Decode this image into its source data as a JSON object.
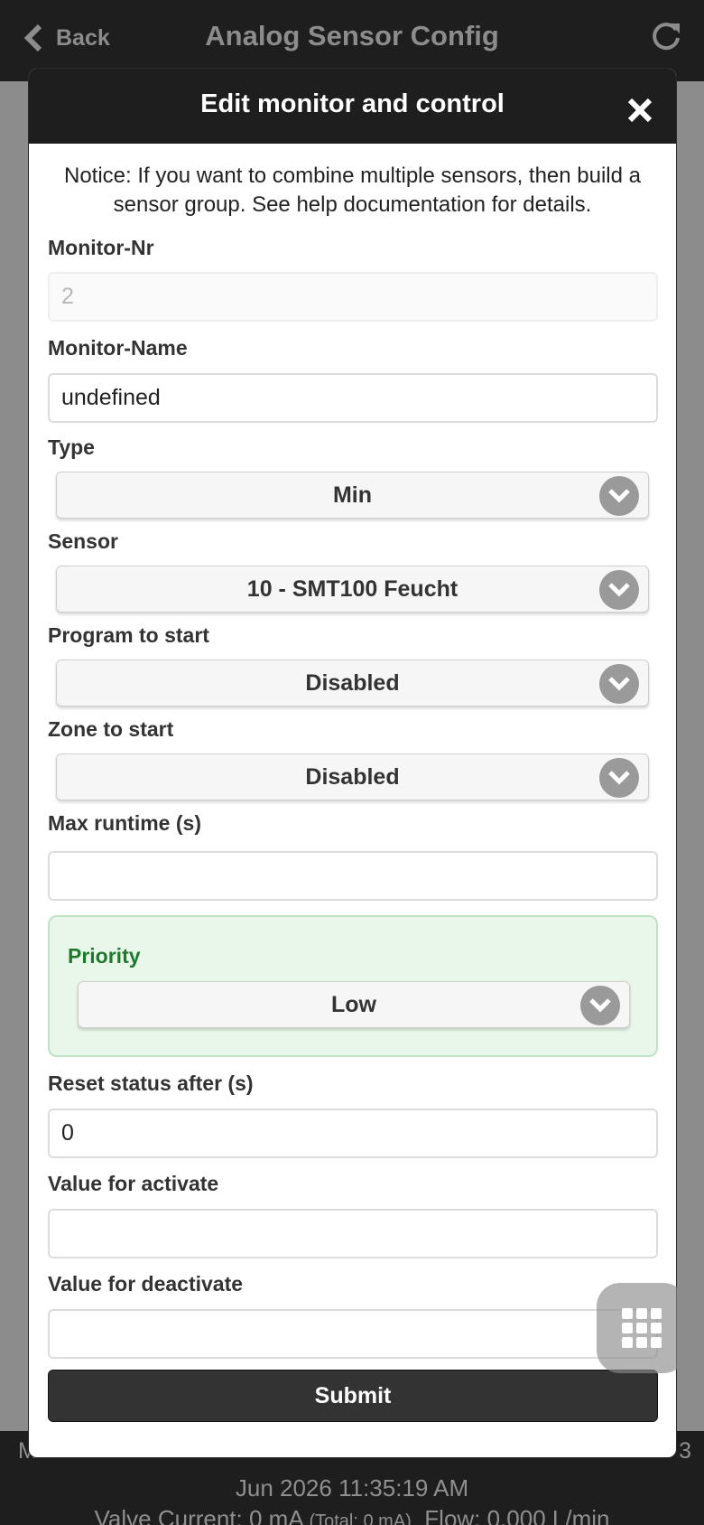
{
  "appbar": {
    "back_label": "Back",
    "title": "Analog Sensor Config"
  },
  "dialog": {
    "title": "Edit monitor and control",
    "notice": "Notice: If you want to combine multiple sensors, then build a sensor group. See help documentation for details.",
    "monitor_nr": {
      "label": "Monitor-Nr",
      "value": "2"
    },
    "monitor_name": {
      "label": "Monitor-Name",
      "value": "undefined"
    },
    "type": {
      "label": "Type",
      "selected": "Min"
    },
    "sensor": {
      "label": "Sensor",
      "selected": "10 - SMT100 Feucht"
    },
    "program": {
      "label": "Program to start",
      "selected": "Disabled"
    },
    "zone": {
      "label": "Zone to start",
      "selected": "Disabled"
    },
    "max_runtime": {
      "label": "Max runtime (s)",
      "value": ""
    },
    "priority": {
      "label": "Priority",
      "selected": "Low"
    },
    "reset_status": {
      "label": "Reset status after (s)",
      "value": "0"
    },
    "value_activate": {
      "label": "Value for activate",
      "value": ""
    },
    "value_deactivate": {
      "label": "Value for deactivate",
      "value": ""
    },
    "submit_label": "Submit"
  },
  "footer": {
    "left_edge": "M",
    "right_edge": "3",
    "datetime": "Jun 2026 11:35:19 AM",
    "valve_current": "Valve Current: 0 mA",
    "total": "(Total: 0 mA)",
    "flow": "Flow: 0.000 L/min"
  },
  "colors": {
    "appbar": "#1e1e1e",
    "priority_bg": "#e8f7ea",
    "priority_text": "#1e7a2a",
    "submit": "#333333"
  }
}
